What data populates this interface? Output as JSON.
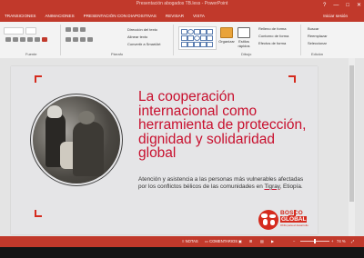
{
  "window": {
    "title": "Presentación abogados TB.less - PowerPoint",
    "controls": [
      "?",
      "—",
      "□",
      "✕"
    ]
  },
  "ribbon": {
    "tabs": [
      "TRANSICIONES",
      "ANIMACIONES",
      "PRESENTACIÓN CON DIAPOSITIVAS",
      "REVISAR",
      "VISTA"
    ],
    "signin": "Iniciar sesión",
    "groups": [
      "Fuente",
      "Párrafo",
      "Dibujo",
      "Edición"
    ],
    "paragraph_items": [
      "Dirección del texto",
      "Alinear texto",
      "Convertir a SmartArt"
    ],
    "drawing_items": [
      "Organizar",
      "Estilos rápidos",
      "Relleno de forma",
      "Contorno de forma",
      "Efectos de forma"
    ],
    "editing_items": [
      "Buscar",
      "Reemplazar",
      "Seleccionar"
    ]
  },
  "slide": {
    "headline": "La cooperación internacional como herramienta de protección, dignidad y solidaridad global",
    "body_pre": "Atención y asistencia a las personas más vulnerables afectadas por los conflictos bélicos de las comunidades en ",
    "body_link": "Tigray",
    "body_post": ", Etiopía.",
    "logo": {
      "line1": "BOSCO",
      "line2": "GLOBAL",
      "line3": "ONG para el desarrollo"
    }
  },
  "status": {
    "notes": "NOTAS",
    "comments": "COMENTARIOS",
    "zoom": "74 %"
  },
  "colors": {
    "accent": "#c1392b",
    "brand_red": "#d52b1e",
    "headline": "#c8102e"
  }
}
